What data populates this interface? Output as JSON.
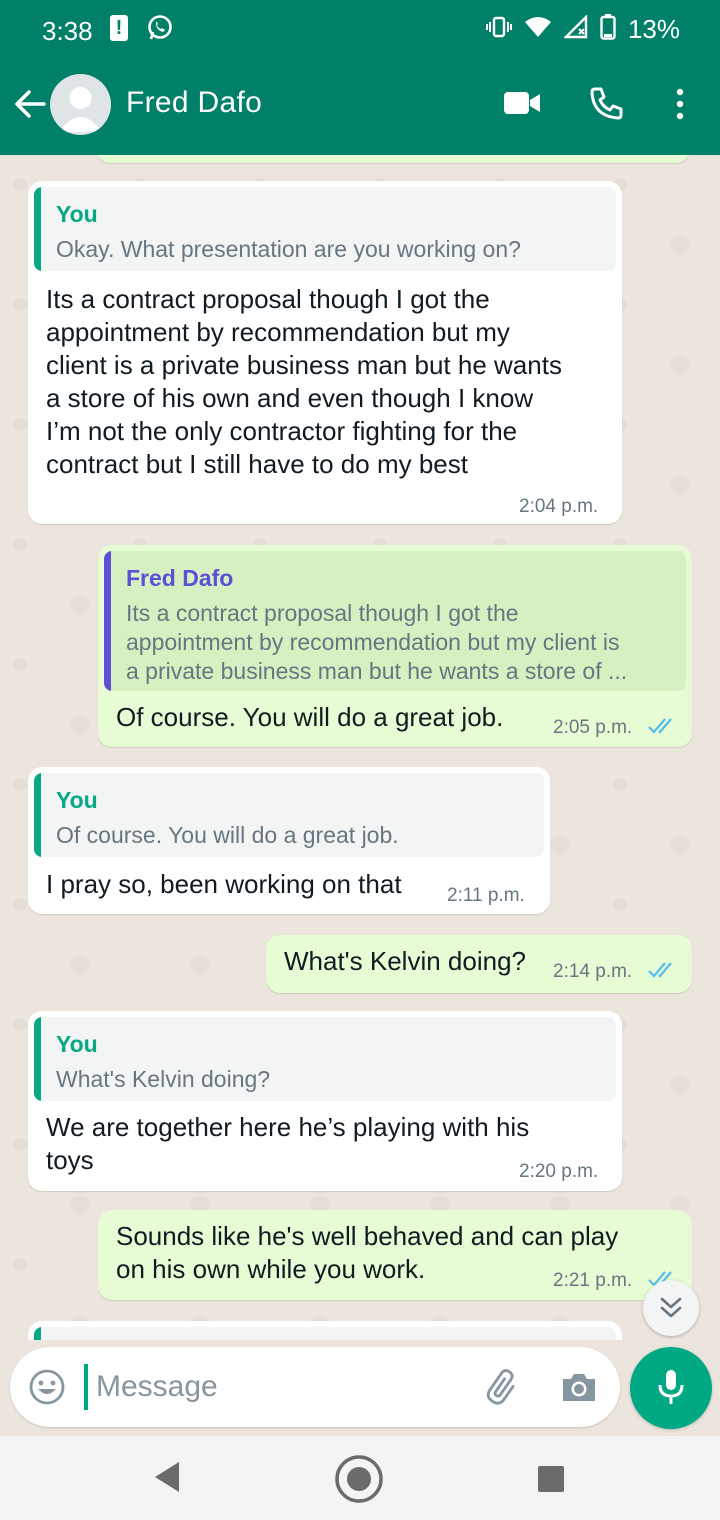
{
  "status_bar": {
    "time": "3:38",
    "battery": "13%"
  },
  "header": {
    "contact_name": "Fred Dafo"
  },
  "messages": [
    {
      "direction": "in",
      "reply": {
        "author": "You",
        "text": "Okay. What presentation are you working on?"
      },
      "lines": [
        "Its a contract proposal though I got the",
        "appointment by recommendation but my",
        "client is a private business man but he wants",
        "a store of his own and even though I know",
        "I’m not the only contractor fighting for the",
        "contract but I still have to do my best"
      ],
      "time": "2:04 p.m."
    },
    {
      "direction": "out",
      "reply": {
        "author": "Fred Dafo",
        "lines": [
          "Its a contract proposal though I got the",
          "appointment by recommendation but my client is",
          "a private business man but he wants a store of ..."
        ]
      },
      "text": "Of course. You will do a great job.",
      "time": "2:05 p.m."
    },
    {
      "direction": "in",
      "reply": {
        "author": "You",
        "text": "Of course. You will do a great job."
      },
      "text": "I pray so, been working on that",
      "time": "2:11 p.m."
    },
    {
      "direction": "out",
      "text": "What's Kelvin doing?",
      "time": "2:14 p.m."
    },
    {
      "direction": "in",
      "reply": {
        "author": "You",
        "text": "What's Kelvin doing?"
      },
      "lines": [
        "We are together here he’s playing with his",
        "toys"
      ],
      "time": "2:20 p.m."
    },
    {
      "direction": "out",
      "lines": [
        "Sounds like he's well behaved and can play",
        "on his own while you work."
      ],
      "time": "2:21 p.m."
    }
  ],
  "composer": {
    "placeholder": "Message"
  },
  "colors": {
    "header": "#008069",
    "accent": "#00a884",
    "incoming_bubble": "#ffffff",
    "outgoing_bubble": "#e7fcd4",
    "reply_bar_you": "#06a885",
    "reply_bar_contact": "#5e4fd6",
    "read_ticks": "#53bdeb"
  },
  "icons": [
    "back-arrow-icon",
    "video-call-icon",
    "voice-call-icon",
    "more-options-icon",
    "emoji-icon",
    "attach-icon",
    "camera-icon",
    "mic-icon",
    "double-chevron-down-icon"
  ]
}
